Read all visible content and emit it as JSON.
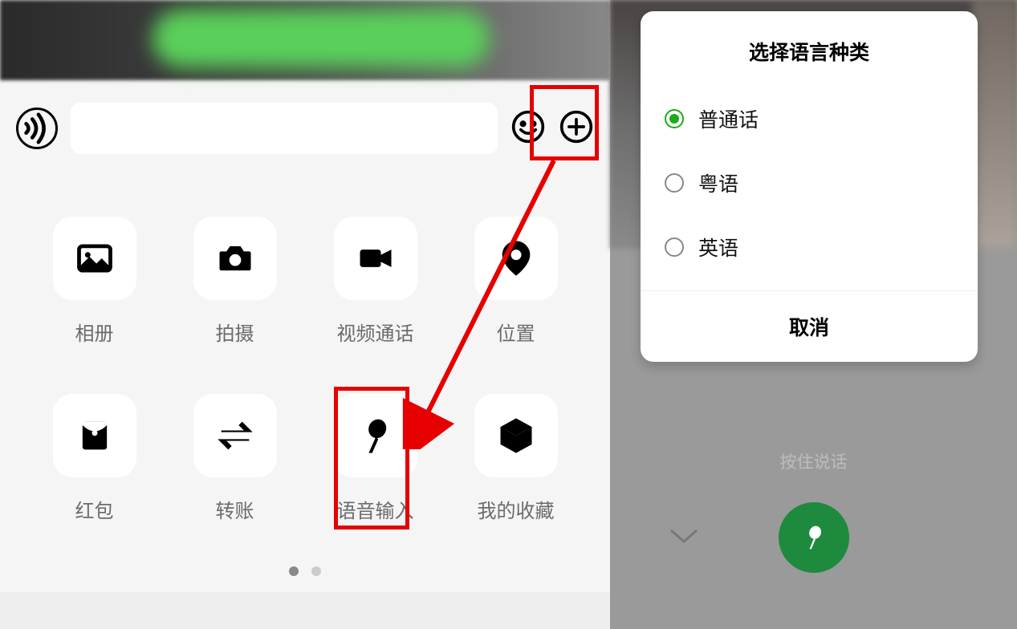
{
  "left": {
    "tools": [
      {
        "key": "album",
        "label": "相册"
      },
      {
        "key": "capture",
        "label": "拍摄"
      },
      {
        "key": "video_call",
        "label": "视频通话"
      },
      {
        "key": "location",
        "label": "位置"
      },
      {
        "key": "red_packet",
        "label": "红包"
      },
      {
        "key": "transfer",
        "label": "转账"
      },
      {
        "key": "voice_input",
        "label": "语音输入"
      },
      {
        "key": "my_favorites",
        "label": "我的收藏"
      }
    ]
  },
  "right": {
    "modal_title": "选择语言种类",
    "languages": [
      {
        "label": "普通话",
        "selected": true
      },
      {
        "label": "粤语",
        "selected": false
      },
      {
        "label": "英语",
        "selected": false
      }
    ],
    "cancel_label": "取消",
    "hold_to_talk_label": "按住说话"
  },
  "colors": {
    "highlight": "#e60000",
    "brand_green": "#1aad19",
    "mic_green": "#1d8a3e"
  }
}
